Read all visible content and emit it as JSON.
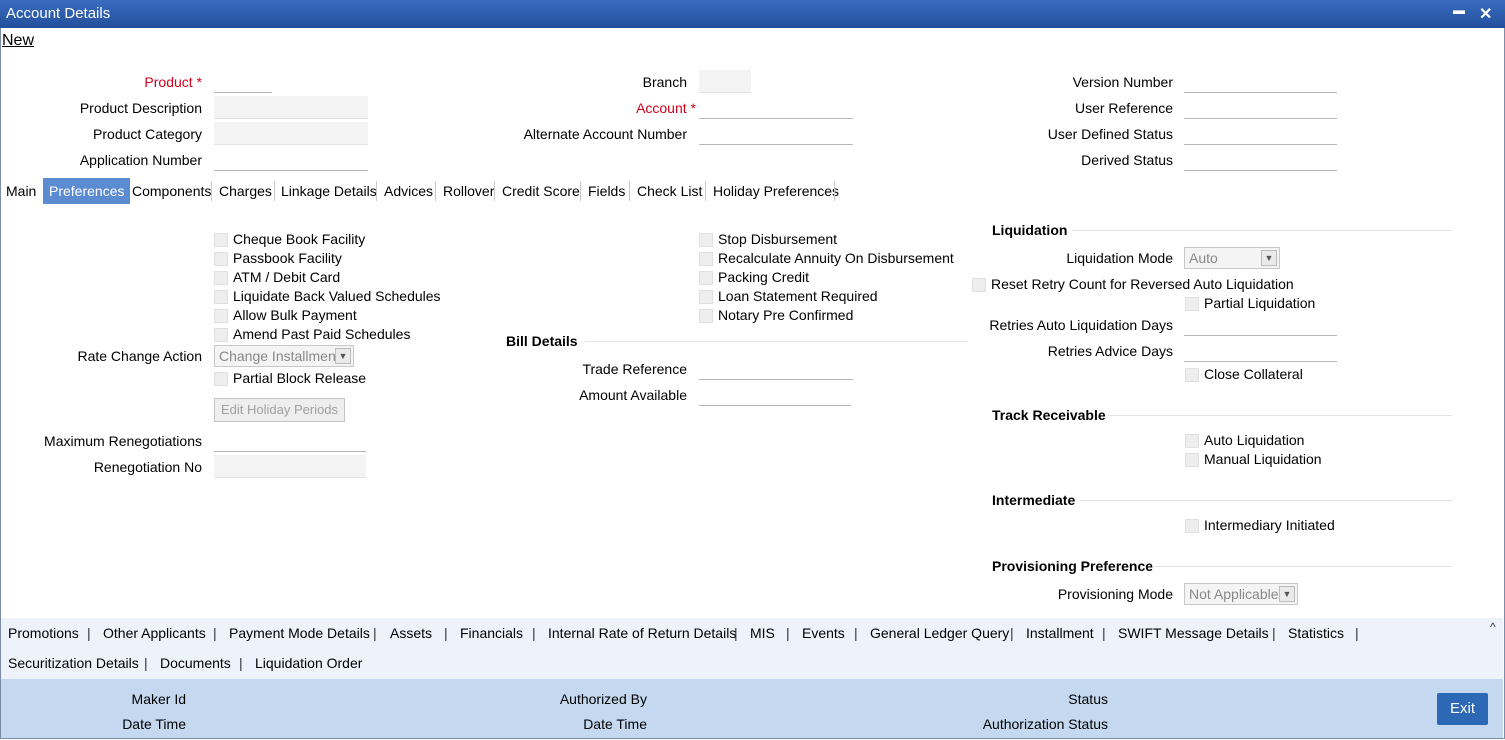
{
  "window": {
    "title": "Account Details",
    "minimize": "▬",
    "close": "✕"
  },
  "toolbar": {
    "new": "New"
  },
  "header": {
    "col1": [
      {
        "label": "Product",
        "required": true
      },
      {
        "label": "Product Description"
      },
      {
        "label": "Product Category"
      },
      {
        "label": "Application Number"
      }
    ],
    "col2": [
      {
        "label": "Branch"
      },
      {
        "label": "Account",
        "required": true
      },
      {
        "label": "Alternate Account Number"
      }
    ],
    "col3": [
      {
        "label": "Version Number"
      },
      {
        "label": "User Reference"
      },
      {
        "label": "User Defined Status"
      },
      {
        "label": "Derived Status"
      }
    ],
    "required_mark": "*"
  },
  "tabs": [
    "Main",
    "Preferences",
    "Components",
    "Charges",
    "Linkage Details",
    "Advices",
    "Rollover",
    "Credit Score",
    "Fields",
    "Check List",
    "Holiday Preferences"
  ],
  "active_tab": "Preferences",
  "prefs_left": {
    "checkboxes": [
      "Cheque Book Facility",
      "Passbook Facility",
      "ATM / Debit Card",
      "Liquidate Back Valued Schedules",
      "Allow Bulk Payment",
      "Amend Past Paid Schedules"
    ],
    "rate_change_label": "Rate Change Action",
    "rate_change_value": "Change Installment",
    "partial_block": "Partial Block Release",
    "edit_holiday": "Edit Holiday Periods",
    "max_reneg": "Maximum Renegotiations",
    "reneg_no": "Renegotiation No"
  },
  "prefs_mid": {
    "checkboxes": [
      "Stop Disbursement",
      "Recalculate Annuity On Disbursement",
      "Packing Credit",
      "Loan Statement Required",
      "Notary Pre Confirmed"
    ],
    "bill_title": "Bill Details",
    "trade_ref": "Trade Reference",
    "amount_avail": "Amount Available"
  },
  "prefs_right": {
    "liq_title": "Liquidation",
    "liq_mode_label": "Liquidation Mode",
    "liq_mode_value": "Auto",
    "reset_retry": "Reset Retry Count for Reversed Auto Liquidation",
    "partial_liq": "Partial Liquidation",
    "retries_auto": "Retries Auto Liquidation Days",
    "retries_advice": "Retries Advice Days",
    "close_collateral": "Close Collateral",
    "track_title": "Track Receivable",
    "auto_liq": "Auto Liquidation",
    "manual_liq": "Manual Liquidation",
    "inter_title": "Intermediate",
    "inter_init": "Intermediary Initiated",
    "prov_title": "Provisioning Preference",
    "prov_mode_label": "Provisioning Mode",
    "prov_mode_value": "Not Applicable"
  },
  "bottom_links": {
    "row1": [
      "Promotions",
      "Other Applicants",
      "Payment Mode Details",
      "Assets",
      "Financials",
      "Internal Rate of Return Details",
      "MIS",
      "Events",
      "General Ledger Query",
      "Installment",
      "SWIFT Message Details",
      "Statistics"
    ],
    "row2": [
      "Securitization Details",
      "Documents",
      "Liquidation Order"
    ],
    "separator": "|",
    "collapse": "^"
  },
  "footer": {
    "maker_id": "Maker Id",
    "date_time": "Date Time",
    "authorized_by": "Authorized By",
    "date_time2": "Date Time",
    "status": "Status",
    "auth_status": "Authorization Status",
    "exit": "Exit"
  }
}
